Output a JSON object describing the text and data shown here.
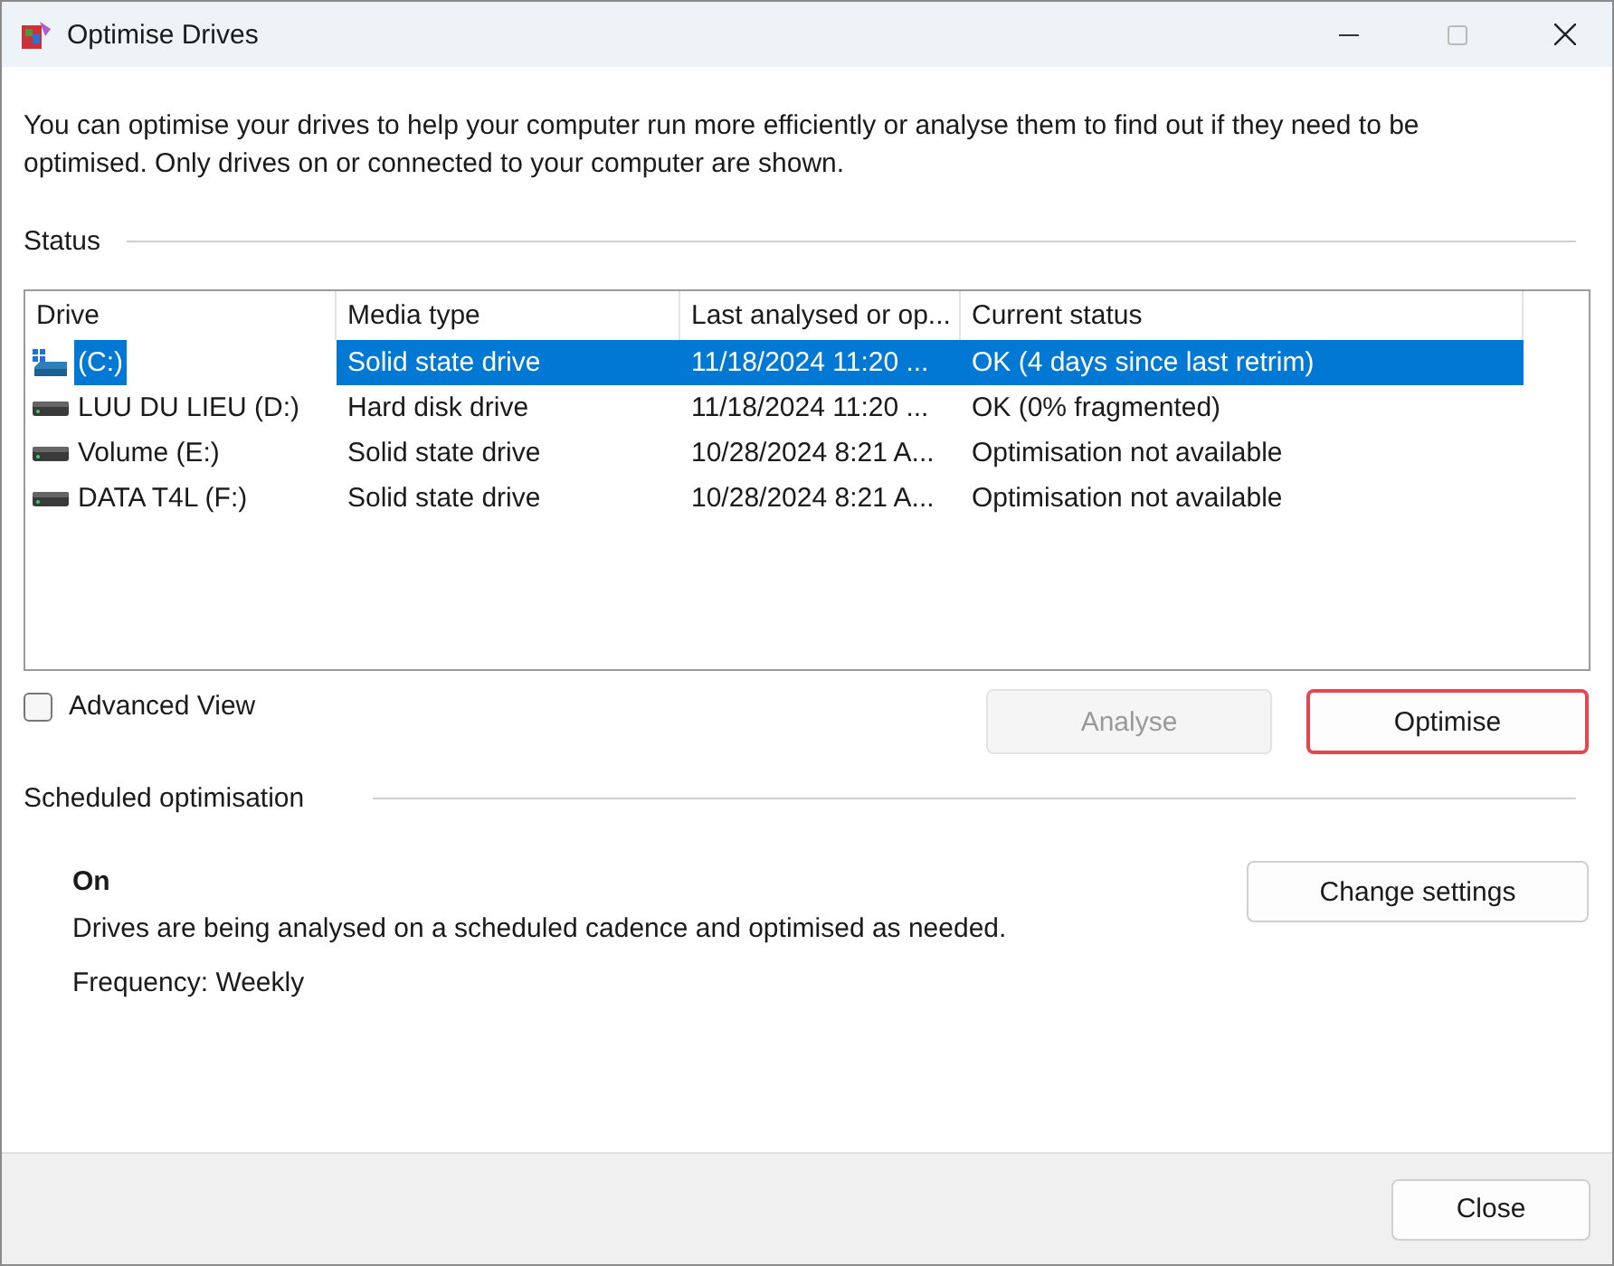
{
  "window": {
    "title": "Optimise Drives"
  },
  "intro": "You can optimise your drives to help your computer run more efficiently or analyse them to find out if they need to be optimised. Only drives on or connected to your computer are shown.",
  "status": {
    "heading": "Status",
    "columns": [
      "Drive",
      "Media type",
      "Last analysed or op...",
      "Current status"
    ],
    "rows": [
      {
        "kind": "system",
        "drive": "(C:)",
        "media": "Solid state drive",
        "last": "11/18/2024 11:20 ...",
        "status": "OK (4 days since last retrim)",
        "selected": true
      },
      {
        "kind": "disk",
        "drive": "LUU DU LIEU (D:)",
        "media": "Hard disk drive",
        "last": "11/18/2024 11:20 ...",
        "status": "OK (0% fragmented)",
        "selected": false
      },
      {
        "kind": "disk",
        "drive": "Volume (E:)",
        "media": "Solid state drive",
        "last": "10/28/2024 8:21 A...",
        "status": "Optimisation not available",
        "selected": false
      },
      {
        "kind": "disk",
        "drive": "DATA T4L (F:)",
        "media": "Solid state drive",
        "last": "10/28/2024 8:21 A...",
        "status": "Optimisation not available",
        "selected": false
      }
    ]
  },
  "advanced_view": {
    "label": "Advanced View",
    "checked": false
  },
  "analyse_button": {
    "label": "Analyse",
    "disabled": true
  },
  "optimise_button": {
    "label": "Optimise",
    "disabled": false,
    "highlighted": true
  },
  "scheduled": {
    "heading": "Scheduled optimisation",
    "state": "On",
    "description": "Drives are being analysed on a scheduled cadence and optimised as needed.",
    "frequency": "Frequency: Weekly",
    "button": "Change settings"
  },
  "close_button": "Close"
}
